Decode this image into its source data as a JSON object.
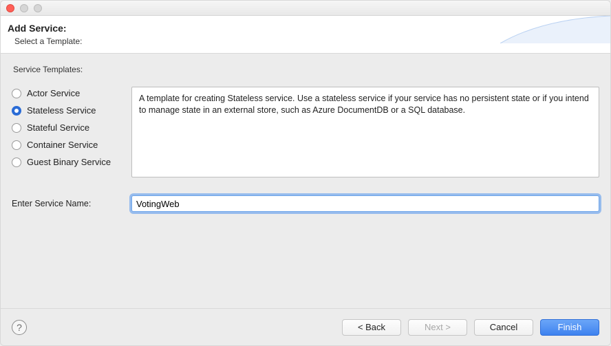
{
  "header": {
    "title": "Add Service:",
    "subtitle": "Select a Template:"
  },
  "group": {
    "label": "Service Templates:"
  },
  "templates": {
    "items": [
      {
        "label": "Actor Service"
      },
      {
        "label": "Stateless Service"
      },
      {
        "label": "Stateful Service"
      },
      {
        "label": "Container Service"
      },
      {
        "label": "Guest Binary Service"
      }
    ],
    "selected_index": 1,
    "description": "A template for creating Stateless service.  Use a stateless service if your service has no persistent state or if you intend to manage state in an external store, such as Azure DocumentDB or a SQL database."
  },
  "service_name": {
    "label": "Enter Service Name:",
    "value": "VotingWeb"
  },
  "buttons": {
    "back": "< Back",
    "next": "Next >",
    "cancel": "Cancel",
    "finish": "Finish"
  }
}
